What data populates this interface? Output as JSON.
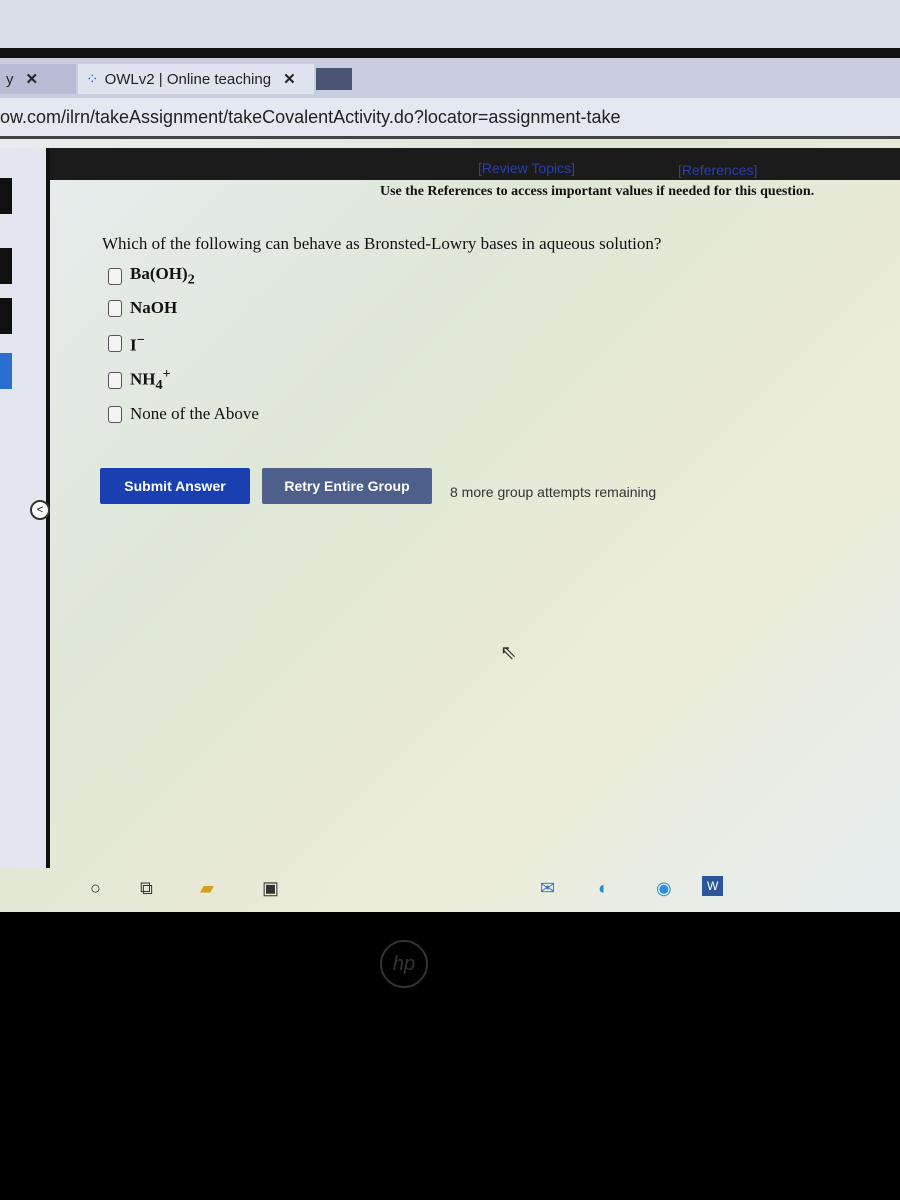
{
  "browser": {
    "prev_tab_label": "y",
    "active_tab_label": "OWLv2 | Online teaching",
    "close_glyph": "✕",
    "url": "ow.com/ilrn/takeAssignment/takeCovalentActivity.do?locator=assignment-take"
  },
  "header": {
    "review_topics": "[Review Topics]",
    "references": "[References]",
    "note": "Use the References to access important values if needed for this question."
  },
  "question": {
    "text": "Which of the following can behave as Bronsted-Lowry bases in aqueous solution?",
    "options": [
      {
        "base": "Ba(OH)",
        "sub": "2",
        "sup": "",
        "checked": false
      },
      {
        "base": "NaOH",
        "sub": "",
        "sup": "",
        "checked": false
      },
      {
        "base": "I",
        "sub": "",
        "sup": "−",
        "checked": false
      },
      {
        "base": "NH",
        "sub": "4",
        "sup": "+",
        "checked": false
      },
      {
        "base": "None of the Above",
        "sub": "",
        "sup": "",
        "checked": false
      }
    ]
  },
  "actions": {
    "submit": "Submit Answer",
    "retry": "Retry Entire Group",
    "attempts": "8 more group attempts remaining"
  },
  "colors": {
    "submit": "#1a3fb0",
    "retry": "#4e5f8c",
    "link": "#2a3fb0"
  },
  "taskbar": {
    "word_label": "W"
  },
  "logo": "hp"
}
